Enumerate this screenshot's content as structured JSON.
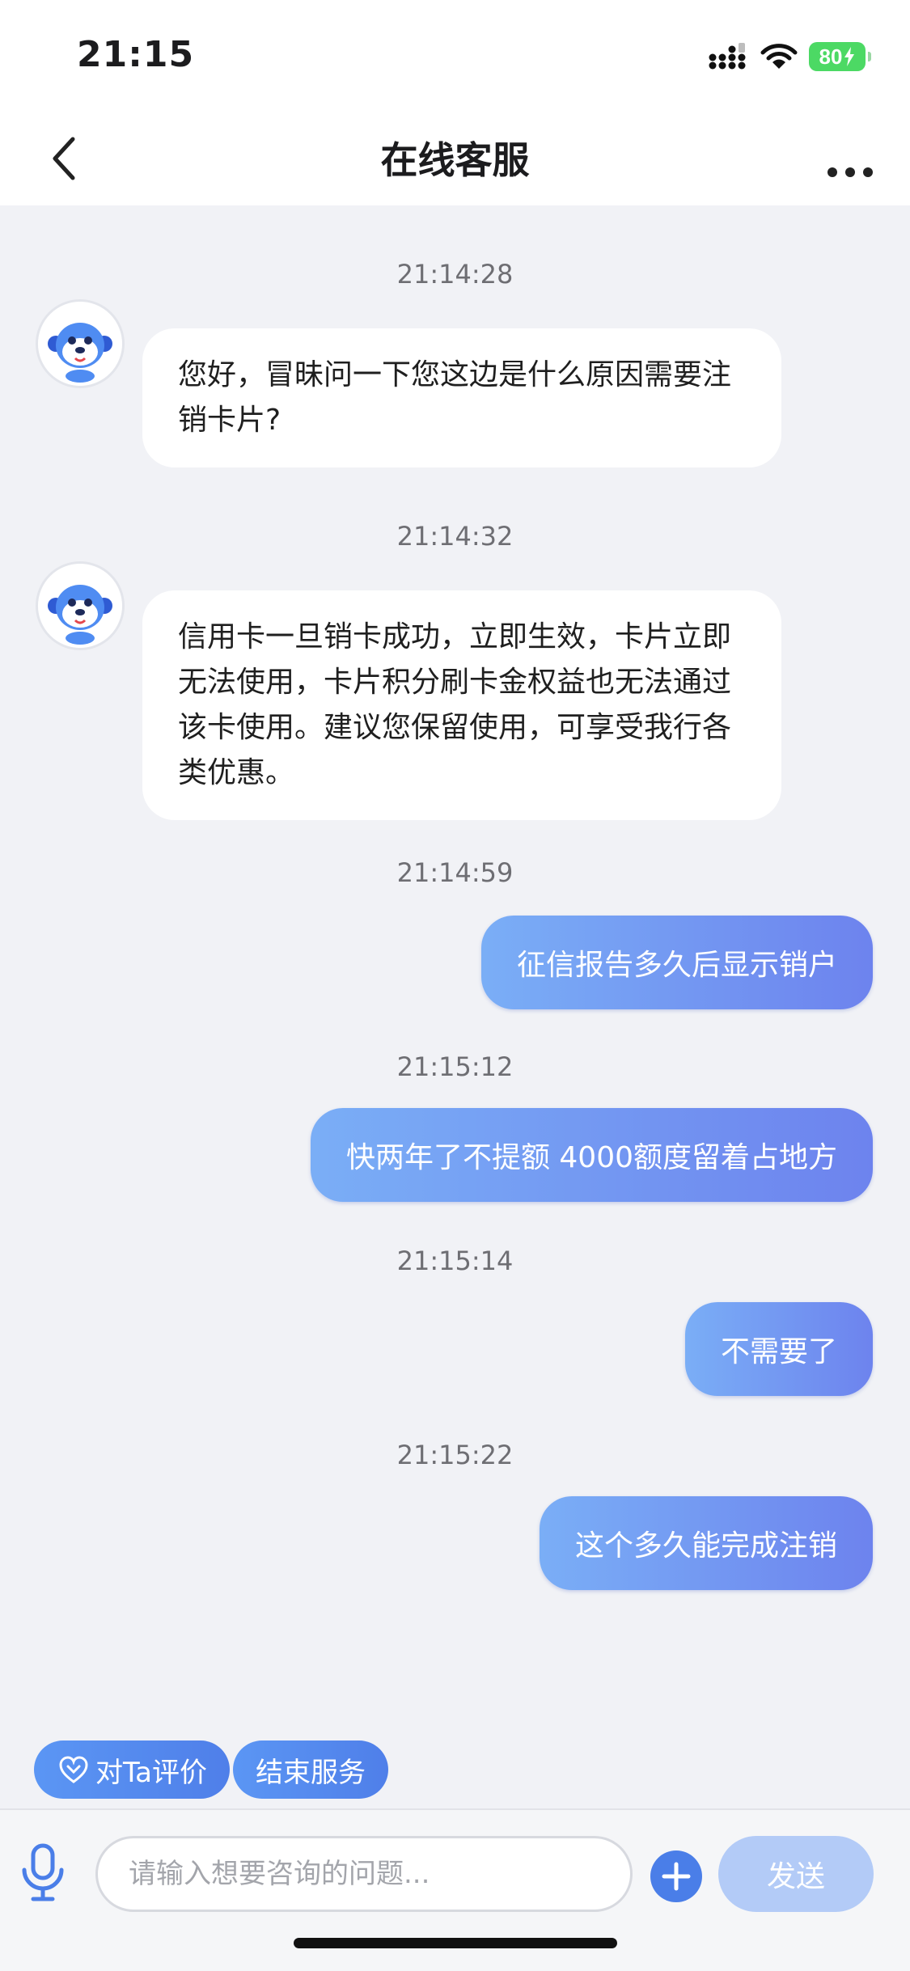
{
  "status": {
    "time": "21:15",
    "battery": "80",
    "signal_icon": "cellular-signal-icon",
    "wifi_icon": "wifi-icon",
    "charging_icon": "bolt-icon"
  },
  "nav": {
    "title": "在线客服",
    "back_icon": "chevron-left-icon",
    "more_icon": "more-dots-icon"
  },
  "messages": [
    {
      "time": "21:14:28",
      "from": "agent",
      "text": "您好，冒昧问一下您这边是什么原因需要注销卡片?"
    },
    {
      "time": "21:14:32",
      "from": "agent",
      "text": "信用卡一旦销卡成功，立即生效，卡片立即无法使用，卡片积分刷卡金权益也无法通过该卡使用。建议您保留使用，可享受我行各类优惠。"
    },
    {
      "time": "21:14:59",
      "from": "user",
      "text": "征信报告多久后显示销户"
    },
    {
      "time": "21:15:12",
      "from": "user",
      "text": "快两年了不提额 4000额度留着占地方"
    },
    {
      "time": "21:15:14",
      "from": "user",
      "text": "不需要了"
    },
    {
      "time": "21:15:22",
      "from": "user",
      "text": "这个多久能完成注销"
    }
  ],
  "quick_actions": {
    "rate": "对Ta评价",
    "end": "结束服务"
  },
  "input": {
    "placeholder": "请输入想要咨询的问题...",
    "value": "",
    "send_label": "发送"
  },
  "colors": {
    "accent": "#4a7ee8",
    "bubble_out_start": "#7aaef6",
    "bubble_out_end": "#6d83ee",
    "background": "#f1f2f6",
    "battery": "#4cd964"
  }
}
